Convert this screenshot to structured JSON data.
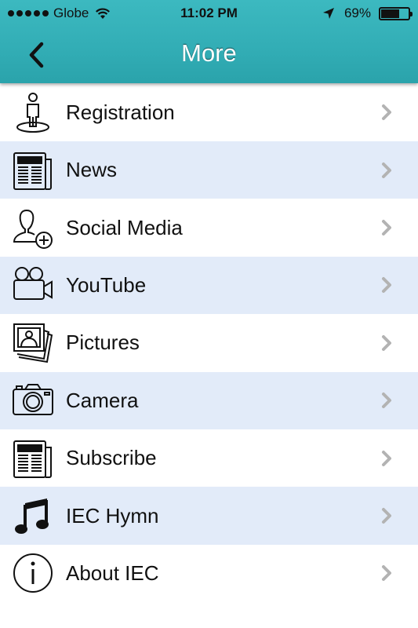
{
  "status": {
    "carrier": "Globe",
    "time": "11:02 PM",
    "battery": "69%",
    "battery_level": 0.69
  },
  "nav": {
    "title": "More",
    "back_icon": "chevron-left-icon"
  },
  "colors": {
    "header": "#32adb5",
    "row_alt": "#e2ebf9",
    "chevron": "#b3b3b3"
  },
  "menu": {
    "items": [
      {
        "label": "Registration",
        "icon": "person-pedestal-icon"
      },
      {
        "label": "News",
        "icon": "newspaper-icon"
      },
      {
        "label": "Social Media",
        "icon": "add-user-icon"
      },
      {
        "label": "YouTube",
        "icon": "video-camera-icon"
      },
      {
        "label": "Pictures",
        "icon": "photos-icon"
      },
      {
        "label": "Camera",
        "icon": "camera-icon"
      },
      {
        "label": "Subscribe",
        "icon": "newspaper-icon"
      },
      {
        "label": "IEC Hymn",
        "icon": "music-note-icon"
      },
      {
        "label": "About IEC",
        "icon": "info-icon"
      }
    ]
  }
}
